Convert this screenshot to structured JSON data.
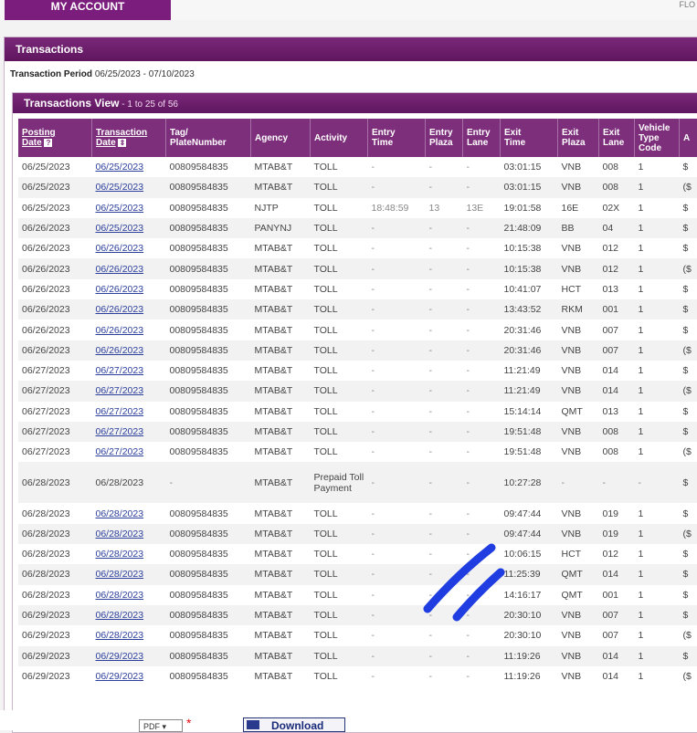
{
  "nav": {
    "my_account": "MY ACCOUNT",
    "corner": "FLO"
  },
  "transactions": {
    "title": "Transactions",
    "period_label": "Transaction Period",
    "period_value": "06/25/2023 - 07/10/2023"
  },
  "view": {
    "title": "Transactions View",
    "range": " - 1 to 25 of 56"
  },
  "columns": {
    "posting_date_line1": "Posting",
    "posting_date_line2": "Date",
    "transaction_date_line1": "Transaction",
    "transaction_date_line2": "Date",
    "tag_line1": "Tag/",
    "tag_line2": "PlateNumber",
    "agency": "Agency",
    "activity": "Activity",
    "entry_time_line1": "Entry",
    "entry_time_line2": "Time",
    "entry_plaza_line1": "Entry",
    "entry_plaza_line2": "Plaza",
    "entry_lane_line1": "Entry",
    "entry_lane_line2": "Lane",
    "exit_time_line1": "Exit",
    "exit_time_line2": "Time",
    "exit_plaza_line1": "Exit",
    "exit_plaza_line2": "Plaza",
    "exit_lane_line1": "Exit",
    "exit_lane_line2": "Lane",
    "vehicle_line1": "Vehicle",
    "vehicle_line2": "Type",
    "vehicle_line3": "Code",
    "amount": "A"
  },
  "rows": [
    [
      "06/25/2023",
      "06/25/2023",
      "00809584835",
      "MTAB&T",
      "TOLL",
      "-",
      "-",
      "-",
      "03:01:15",
      "VNB",
      "008",
      "1",
      "$"
    ],
    [
      "06/25/2023",
      "06/25/2023",
      "00809584835",
      "MTAB&T",
      "TOLL",
      "-",
      "-",
      "-",
      "03:01:15",
      "VNB",
      "008",
      "1",
      "($"
    ],
    [
      "06/25/2023",
      "06/25/2023",
      "00809584835",
      "NJTP",
      "TOLL",
      "18:48:59",
      "13",
      "13E",
      "19:01:58",
      "16E",
      "02X",
      "1",
      "$"
    ],
    [
      "06/26/2023",
      "06/25/2023",
      "00809584835",
      "PANYNJ",
      "TOLL",
      "-",
      "-",
      "-",
      "21:48:09",
      "BB",
      "04",
      "1",
      "$"
    ],
    [
      "06/26/2023",
      "06/26/2023",
      "00809584835",
      "MTAB&T",
      "TOLL",
      "-",
      "-",
      "-",
      "10:15:38",
      "VNB",
      "012",
      "1",
      "$"
    ],
    [
      "06/26/2023",
      "06/26/2023",
      "00809584835",
      "MTAB&T",
      "TOLL",
      "-",
      "-",
      "-",
      "10:15:38",
      "VNB",
      "012",
      "1",
      "($"
    ],
    [
      "06/26/2023",
      "06/26/2023",
      "00809584835",
      "MTAB&T",
      "TOLL",
      "-",
      "-",
      "-",
      "10:41:07",
      "HCT",
      "013",
      "1",
      "$"
    ],
    [
      "06/26/2023",
      "06/26/2023",
      "00809584835",
      "MTAB&T",
      "TOLL",
      "-",
      "-",
      "-",
      "13:43:52",
      "RKM",
      "001",
      "1",
      "$"
    ],
    [
      "06/26/2023",
      "06/26/2023",
      "00809584835",
      "MTAB&T",
      "TOLL",
      "-",
      "-",
      "-",
      "20:31:46",
      "VNB",
      "007",
      "1",
      "$"
    ],
    [
      "06/26/2023",
      "06/26/2023",
      "00809584835",
      "MTAB&T",
      "TOLL",
      "-",
      "-",
      "-",
      "20:31:46",
      "VNB",
      "007",
      "1",
      "($"
    ],
    [
      "06/27/2023",
      "06/27/2023",
      "00809584835",
      "MTAB&T",
      "TOLL",
      "-",
      "-",
      "-",
      "11:21:49",
      "VNB",
      "014",
      "1",
      "$"
    ],
    [
      "06/27/2023",
      "06/27/2023",
      "00809584835",
      "MTAB&T",
      "TOLL",
      "-",
      "-",
      "-",
      "11:21:49",
      "VNB",
      "014",
      "1",
      "($"
    ],
    [
      "06/27/2023",
      "06/27/2023",
      "00809584835",
      "MTAB&T",
      "TOLL",
      "-",
      "-",
      "-",
      "15:14:14",
      "QMT",
      "013",
      "1",
      "$"
    ],
    [
      "06/27/2023",
      "06/27/2023",
      "00809584835",
      "MTAB&T",
      "TOLL",
      "-",
      "-",
      "-",
      "19:51:48",
      "VNB",
      "008",
      "1",
      "$"
    ],
    [
      "06/27/2023",
      "06/27/2023",
      "00809584835",
      "MTAB&T",
      "TOLL",
      "-",
      "-",
      "-",
      "19:51:48",
      "VNB",
      "008",
      "1",
      "($"
    ],
    [
      "06/28/2023",
      "06/28/2023",
      "-",
      "MTAB&T",
      "Prepaid Toll Payment",
      "-",
      "-",
      "-",
      "10:27:28",
      "-",
      "-",
      "-",
      "$"
    ],
    [
      "06/28/2023",
      "06/28/2023",
      "00809584835",
      "MTAB&T",
      "TOLL",
      "-",
      "-",
      "-",
      "09:47:44",
      "VNB",
      "019",
      "1",
      "$"
    ],
    [
      "06/28/2023",
      "06/28/2023",
      "00809584835",
      "MTAB&T",
      "TOLL",
      "-",
      "-",
      "-",
      "09:47:44",
      "VNB",
      "019",
      "1",
      "($"
    ],
    [
      "06/28/2023",
      "06/28/2023",
      "00809584835",
      "MTAB&T",
      "TOLL",
      "-",
      "-",
      "-",
      "10:06:15",
      "HCT",
      "012",
      "1",
      "$"
    ],
    [
      "06/28/2023",
      "06/28/2023",
      "00809584835",
      "MTAB&T",
      "TOLL",
      "-",
      "-",
      "-",
      "11:25:39",
      "QMT",
      "014",
      "1",
      "$"
    ],
    [
      "06/28/2023",
      "06/28/2023",
      "00809584835",
      "MTAB&T",
      "TOLL",
      "-",
      "-",
      "-",
      "14:16:17",
      "QMT",
      "001",
      "1",
      "$"
    ],
    [
      "06/29/2023",
      "06/28/2023",
      "00809584835",
      "MTAB&T",
      "TOLL",
      "-",
      "-",
      "-",
      "20:30:10",
      "VNB",
      "007",
      "1",
      "$"
    ],
    [
      "06/29/2023",
      "06/28/2023",
      "00809584835",
      "MTAB&T",
      "TOLL",
      "-",
      "-",
      "-",
      "20:30:10",
      "VNB",
      "007",
      "1",
      "($"
    ],
    [
      "06/29/2023",
      "06/29/2023",
      "00809584835",
      "MTAB&T",
      "TOLL",
      "-",
      "-",
      "-",
      "11:19:26",
      "VNB",
      "014",
      "1",
      "$"
    ],
    [
      "06/29/2023",
      "06/29/2023",
      "00809584835",
      "MTAB&T",
      "TOLL",
      "-",
      "-",
      "-",
      "11:19:26",
      "VNB",
      "014",
      "1",
      "($"
    ]
  ],
  "tall_row_index": 15,
  "linked_transaction_date": [
    true,
    true,
    true,
    true,
    true,
    true,
    true,
    true,
    true,
    true,
    true,
    true,
    true,
    true,
    true,
    false,
    true,
    true,
    true,
    true,
    true,
    true,
    true,
    true,
    true
  ],
  "footer": {
    "format_selected": "PDF",
    "download_label": "Download"
  },
  "colors": {
    "brand": "#7b1d7d",
    "link": "#2b3e9c",
    "scribble": "#1f3de0"
  }
}
